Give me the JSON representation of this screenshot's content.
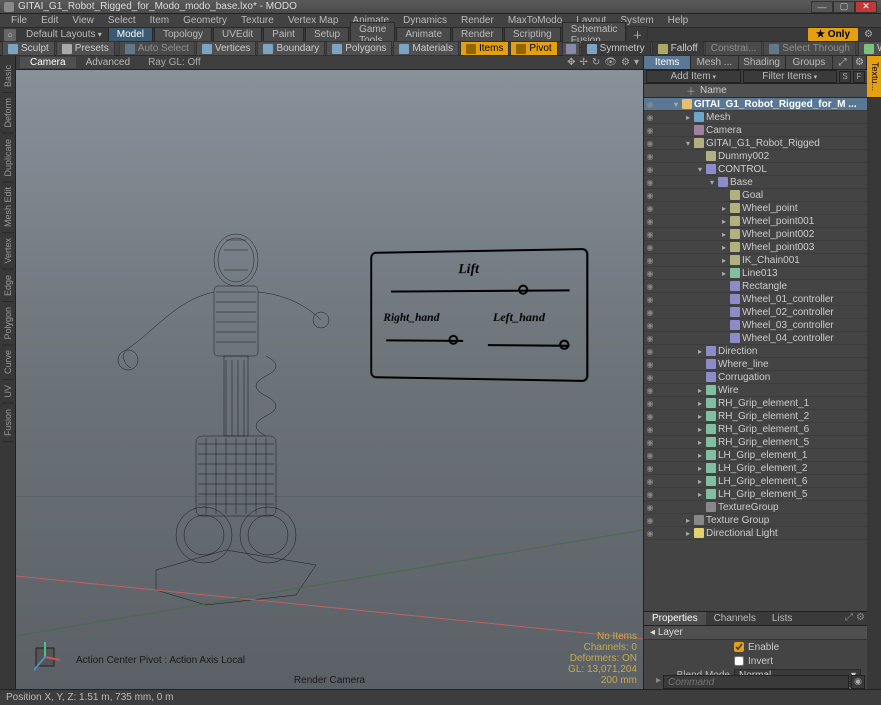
{
  "title": "GITAI_G1_Robot_Rigged_for_Modo_modo_base.lxo* - MODO",
  "menus": [
    "File",
    "Edit",
    "View",
    "Select",
    "Item",
    "Geometry",
    "Texture",
    "Vertex Map",
    "Animate",
    "Dynamics",
    "Render",
    "MaxToModo",
    "Layout",
    "System",
    "Help"
  ],
  "layout_dropdown": "Default Layouts",
  "layout_tabs": [
    "Model",
    "Topology",
    "UVEdit",
    "Paint",
    "Setup",
    "Game Tools",
    "Animate",
    "Render",
    "Scripting",
    "Schematic Fusion"
  ],
  "layout_active": 0,
  "only": "Only",
  "toolbar": {
    "sculpt": "Sculpt",
    "presets": "Presets",
    "autoselect": "Auto Select",
    "vertices": "Vertices",
    "boundary": "Boundary",
    "polygons": "Polygons",
    "materials": "Materials",
    "items": "Items",
    "pivot": "Pivot",
    "symmetry": "Symmetry",
    "falloff": "Falloff",
    "constraint": "Constrai...",
    "selectthrough": "Select Through",
    "workplane": "WorkPlane"
  },
  "left_rail": [
    "Basic",
    "Deform",
    "Duplicate",
    "Mesh Edit",
    "Vertex",
    "Edge",
    "Polygon",
    "Curve",
    "UV",
    "Fusion"
  ],
  "viewport": {
    "tabs": [
      "Camera",
      "Advanced"
    ],
    "active": 0,
    "raygl": "Ray GL: Off",
    "action_center": "Action Center Pivot : Action Axis Local",
    "render_cam": "Render Camera",
    "stats": {
      "l1": "No Items",
      "l2": "Channels: 0",
      "l3": "Deformers: ON",
      "l4": "GL: 13,071,204",
      "l5": "200 mm"
    }
  },
  "controls": {
    "lift": "Lift",
    "right": "Right_hand",
    "left": "Left_hand"
  },
  "right": {
    "tabs": [
      "Items",
      "Mesh ...",
      "Shading",
      "Groups"
    ],
    "active": 0,
    "add": "Add Item",
    "filter": "Filter Items",
    "name_col": "Name",
    "tree": [
      {
        "d": 0,
        "exp": "▾",
        "ic": "ic-scene",
        "t": "GITAI_G1_Robot_Rigged_for_M ...",
        "hl": true
      },
      {
        "d": 1,
        "exp": "▸",
        "ic": "ic-mesh",
        "t": "Mesh"
      },
      {
        "d": 1,
        "exp": "",
        "ic": "ic-cam",
        "t": "Camera"
      },
      {
        "d": 1,
        "exp": "▾",
        "ic": "ic-loc",
        "t": "GITAI_G1_Robot_Rigged"
      },
      {
        "d": 2,
        "exp": "",
        "ic": "ic-loc",
        "t": "Dummy002"
      },
      {
        "d": 2,
        "exp": "▾",
        "ic": "ic-ctrl",
        "t": "CONTROL"
      },
      {
        "d": 3,
        "exp": "▾",
        "ic": "ic-ctrl",
        "t": "Base"
      },
      {
        "d": 4,
        "exp": "",
        "ic": "ic-loc",
        "t": "Goal"
      },
      {
        "d": 4,
        "exp": "▸",
        "ic": "ic-loc",
        "t": "Wheel_point"
      },
      {
        "d": 4,
        "exp": "▸",
        "ic": "ic-loc",
        "t": "Wheel_point001"
      },
      {
        "d": 4,
        "exp": "▸",
        "ic": "ic-loc",
        "t": "Wheel_point002"
      },
      {
        "d": 4,
        "exp": "▸",
        "ic": "ic-loc",
        "t": "Wheel_point003"
      },
      {
        "d": 4,
        "exp": "▸",
        "ic": "ic-loc",
        "t": "IK_Chain001"
      },
      {
        "d": 4,
        "exp": "▸",
        "ic": "ic-line",
        "t": "Line013"
      },
      {
        "d": 4,
        "exp": "",
        "ic": "ic-ctrl",
        "t": "Rectangle"
      },
      {
        "d": 4,
        "exp": "",
        "ic": "ic-ctrl",
        "t": "Wheel_01_controller"
      },
      {
        "d": 4,
        "exp": "",
        "ic": "ic-ctrl",
        "t": "Wheel_02_controller"
      },
      {
        "d": 4,
        "exp": "",
        "ic": "ic-ctrl",
        "t": "Wheel_03_controller"
      },
      {
        "d": 4,
        "exp": "",
        "ic": "ic-ctrl",
        "t": "Wheel_04_controller"
      },
      {
        "d": 2,
        "exp": "▸",
        "ic": "ic-ctrl",
        "t": "Direction"
      },
      {
        "d": 2,
        "exp": "",
        "ic": "ic-ctrl",
        "t": "Where_line"
      },
      {
        "d": 2,
        "exp": "",
        "ic": "ic-ctrl",
        "t": "Corrugation"
      },
      {
        "d": 2,
        "exp": "▸",
        "ic": "ic-line",
        "t": "Wire"
      },
      {
        "d": 2,
        "exp": "▸",
        "ic": "ic-line",
        "t": "RH_Grip_element_1"
      },
      {
        "d": 2,
        "exp": "▸",
        "ic": "ic-line",
        "t": "RH_Grip_element_2"
      },
      {
        "d": 2,
        "exp": "▸",
        "ic": "ic-line",
        "t": "RH_Grip_element_6"
      },
      {
        "d": 2,
        "exp": "▸",
        "ic": "ic-line",
        "t": "RH_Grip_element_5"
      },
      {
        "d": 2,
        "exp": "▸",
        "ic": "ic-line",
        "t": "LH_Grip_element_1"
      },
      {
        "d": 2,
        "exp": "▸",
        "ic": "ic-line",
        "t": "LH_Grip_element_2"
      },
      {
        "d": 2,
        "exp": "▸",
        "ic": "ic-line",
        "t": "LH_Grip_element_6"
      },
      {
        "d": 2,
        "exp": "▸",
        "ic": "ic-line",
        "t": "LH_Grip_element_5"
      },
      {
        "d": 2,
        "exp": "",
        "ic": "ic-grp",
        "t": "TextureGroup"
      },
      {
        "d": 1,
        "exp": "▸",
        "ic": "ic-grp",
        "t": "Texture Group"
      },
      {
        "d": 1,
        "exp": "▸",
        "ic": "ic-light",
        "t": "Directional Light"
      }
    ],
    "props_tabs": [
      "Properties",
      "Channels",
      "Lists"
    ],
    "props_active": 0,
    "section": "Layer",
    "enable": "Enable",
    "invert": "Invert",
    "blendmode_lbl": "Blend Mode",
    "blendmode_val": "Normal"
  },
  "right_rail": [
    "Textu...",
    ""
  ],
  "command_ph": "Command",
  "status": "Position X, Y, Z:   1.51 m, 735 mm, 0 m"
}
